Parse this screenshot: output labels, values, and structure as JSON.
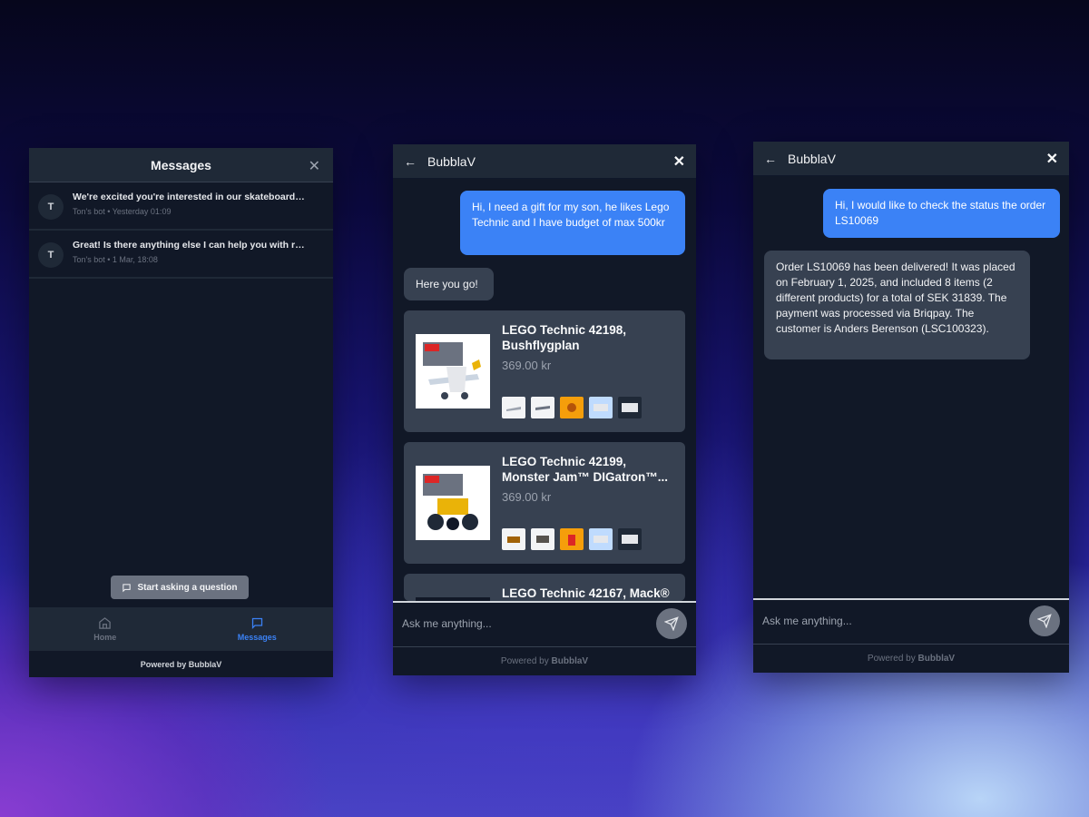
{
  "messages_panel": {
    "title": "Messages",
    "threads": [
      {
        "avatar": "T",
        "message": "We're excited you're interested in our skateboards! ...",
        "meta": "Ton's bot • Yesterday 01:09"
      },
      {
        "avatar": "T",
        "message": "Great! Is there anything else I can help you with reg...",
        "meta": "Ton's bot • 1 Mar, 18:08"
      }
    ],
    "start_button": "Start asking a question",
    "tabs": [
      {
        "label": "Home",
        "icon": "home-icon"
      },
      {
        "label": "Messages",
        "icon": "chat-icon"
      }
    ],
    "footer": "Powered by BubblaV"
  },
  "chat1": {
    "title": "BubblaV",
    "user_message": "Hi, I need a gift for my son, he likes Lego Technic and I have budget of max 500kr",
    "bot_message": "Here you go!",
    "products": [
      {
        "name_line1": "LEGO Technic 42198,",
        "name_line2": "Bushflygplan",
        "price": "369.00 kr"
      },
      {
        "name_line1": "LEGO Technic 42199,",
        "name_line2": "Monster Jam™ DIGatron™...",
        "price": "369.00 kr"
      },
      {
        "name_line1": "LEGO Technic 42167, Mack®",
        "name_line2": "",
        "price": ""
      }
    ],
    "input_placeholder": "Ask me anything...",
    "footer_prefix": "Powered by ",
    "footer_brand": "BubblaV"
  },
  "chat2": {
    "title": "BubblaV",
    "user_message": "Hi, I would like to check the status the order LS10069",
    "bot_message": "Order LS10069 has been delivered! It was placed on February 1, 2025, and included 8 items (2 different products) for a total of SEK 31839. The payment was processed via Briqpay. The customer is Anders Berenson (LSC100323).",
    "input_placeholder": "Ask me anything...",
    "footer_prefix": "Powered by ",
    "footer_brand": "BubblaV"
  },
  "colors": {
    "panel_bg": "#111827",
    "header_bg": "#1f2937",
    "user_bubble": "#3b82f6",
    "bot_bubble": "#374151",
    "active_tab": "#3b82f6"
  }
}
